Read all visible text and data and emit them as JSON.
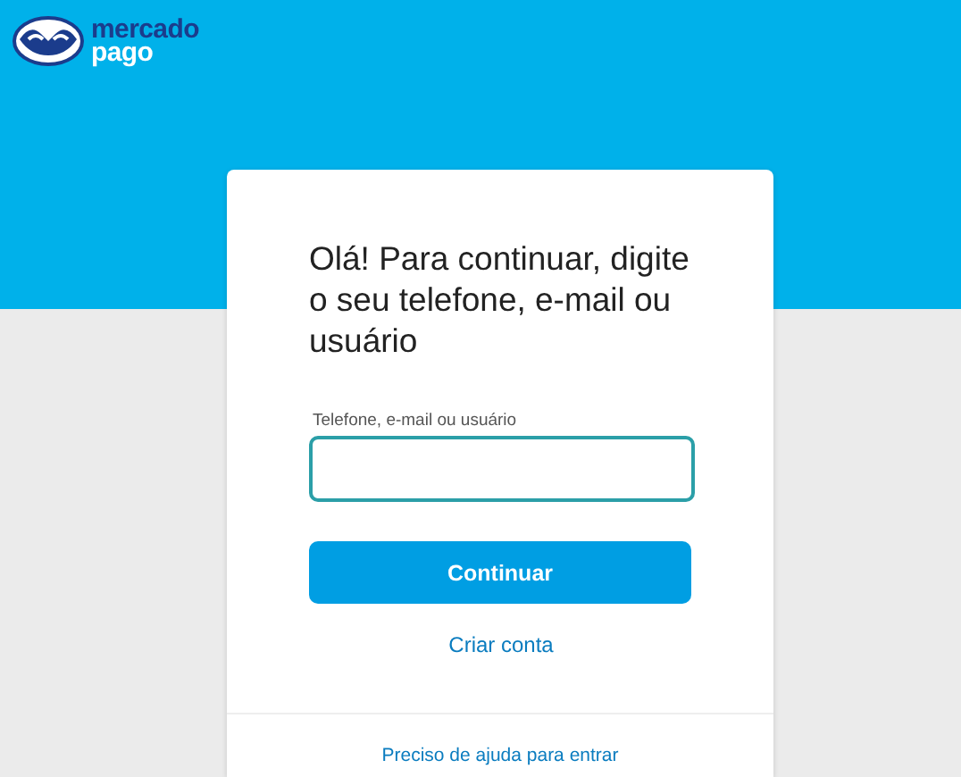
{
  "header": {
    "logo_line_1": "mercado",
    "logo_line_2": "pago"
  },
  "login": {
    "title": "Olá! Para continuar, digite o seu telefone, e-mail ou usuário",
    "field": {
      "label": "Telefone, e-mail ou usuário"
    },
    "submit": "Continuar",
    "create_account": "Criar conta",
    "help": "Preciso de ajuda para entrar"
  }
}
